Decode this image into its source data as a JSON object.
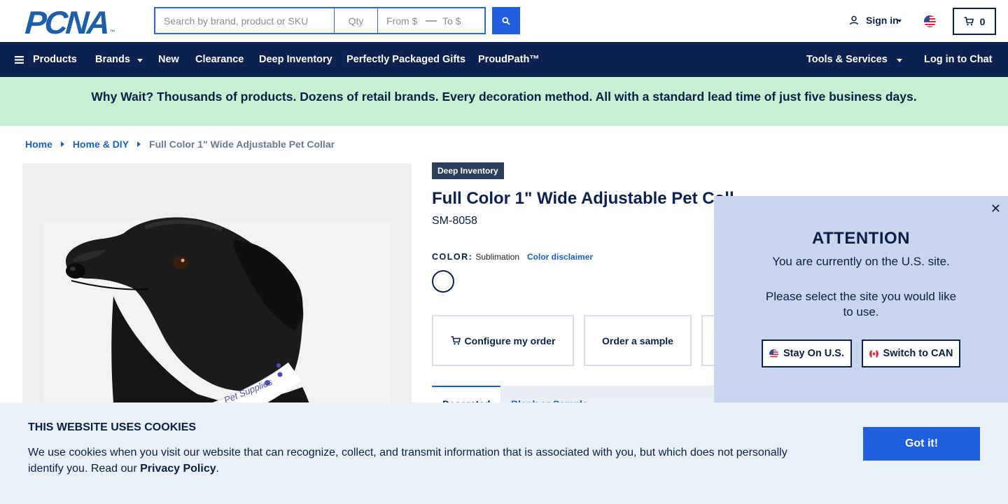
{
  "header": {
    "logo_text": "PCNA",
    "logo_tm": "™",
    "search_placeholder": "Search by brand, product or SKU",
    "qty_placeholder": "Qty",
    "from_placeholder": "From $",
    "to_placeholder": "To $",
    "signin_label": "Sign in",
    "cart_count": "0"
  },
  "nav": {
    "products": "Products",
    "brands": "Brands",
    "new": "New",
    "clearance": "Clearance",
    "deep_inventory": "Deep Inventory",
    "gifts": "Perfectly Packaged Gifts",
    "proudpath": "ProudPath™",
    "tools": "Tools & Services",
    "chat": "Log in to Chat"
  },
  "promo": {
    "text": "Why Wait? Thousands of products. Dozens of retail brands. Every decoration method. All with a standard lead time of just five business days."
  },
  "breadcrumb": {
    "items": [
      "Home",
      "Home & DIY"
    ],
    "current": "Full Color 1\" Wide Adjustable Pet Collar"
  },
  "product": {
    "badge": "Deep Inventory",
    "title": "Full Color 1\" Wide Adjustable Pet Coll",
    "sku": "SM-8058",
    "color_label": "COLOR:",
    "color_value": "Sublimation",
    "color_disclaimer": "Color disclaimer",
    "configure_label": "Configure my order",
    "sample_label": "Order a sample",
    "tab_active": "Decorated",
    "tab_2": "Blank or Sample",
    "collar_print": "Pet Supplies"
  },
  "popup": {
    "title": "ATTENTION",
    "line1": "You are currently on the U.S. site.",
    "line2": "Please select the site you would like to use.",
    "stay_label": "Stay On U.S.",
    "switch_label": "Switch to CAN",
    "close": "✕"
  },
  "cookie": {
    "title": "THIS WEBSITE USES COOKIES",
    "text": "We use cookies when you visit our website that can recognize, collect, and transmit information that is associated with you, but which does not personally identify you. Read our ",
    "link": "Privacy Policy",
    "end": ".",
    "button": "Got it!"
  },
  "colors": {
    "navy": "#0d2150",
    "blue": "#1f5fe0",
    "promo_bg": "#c6efd3",
    "popup_bg": "#c9d6ee",
    "cookie_bg": "#ebf1fb"
  }
}
